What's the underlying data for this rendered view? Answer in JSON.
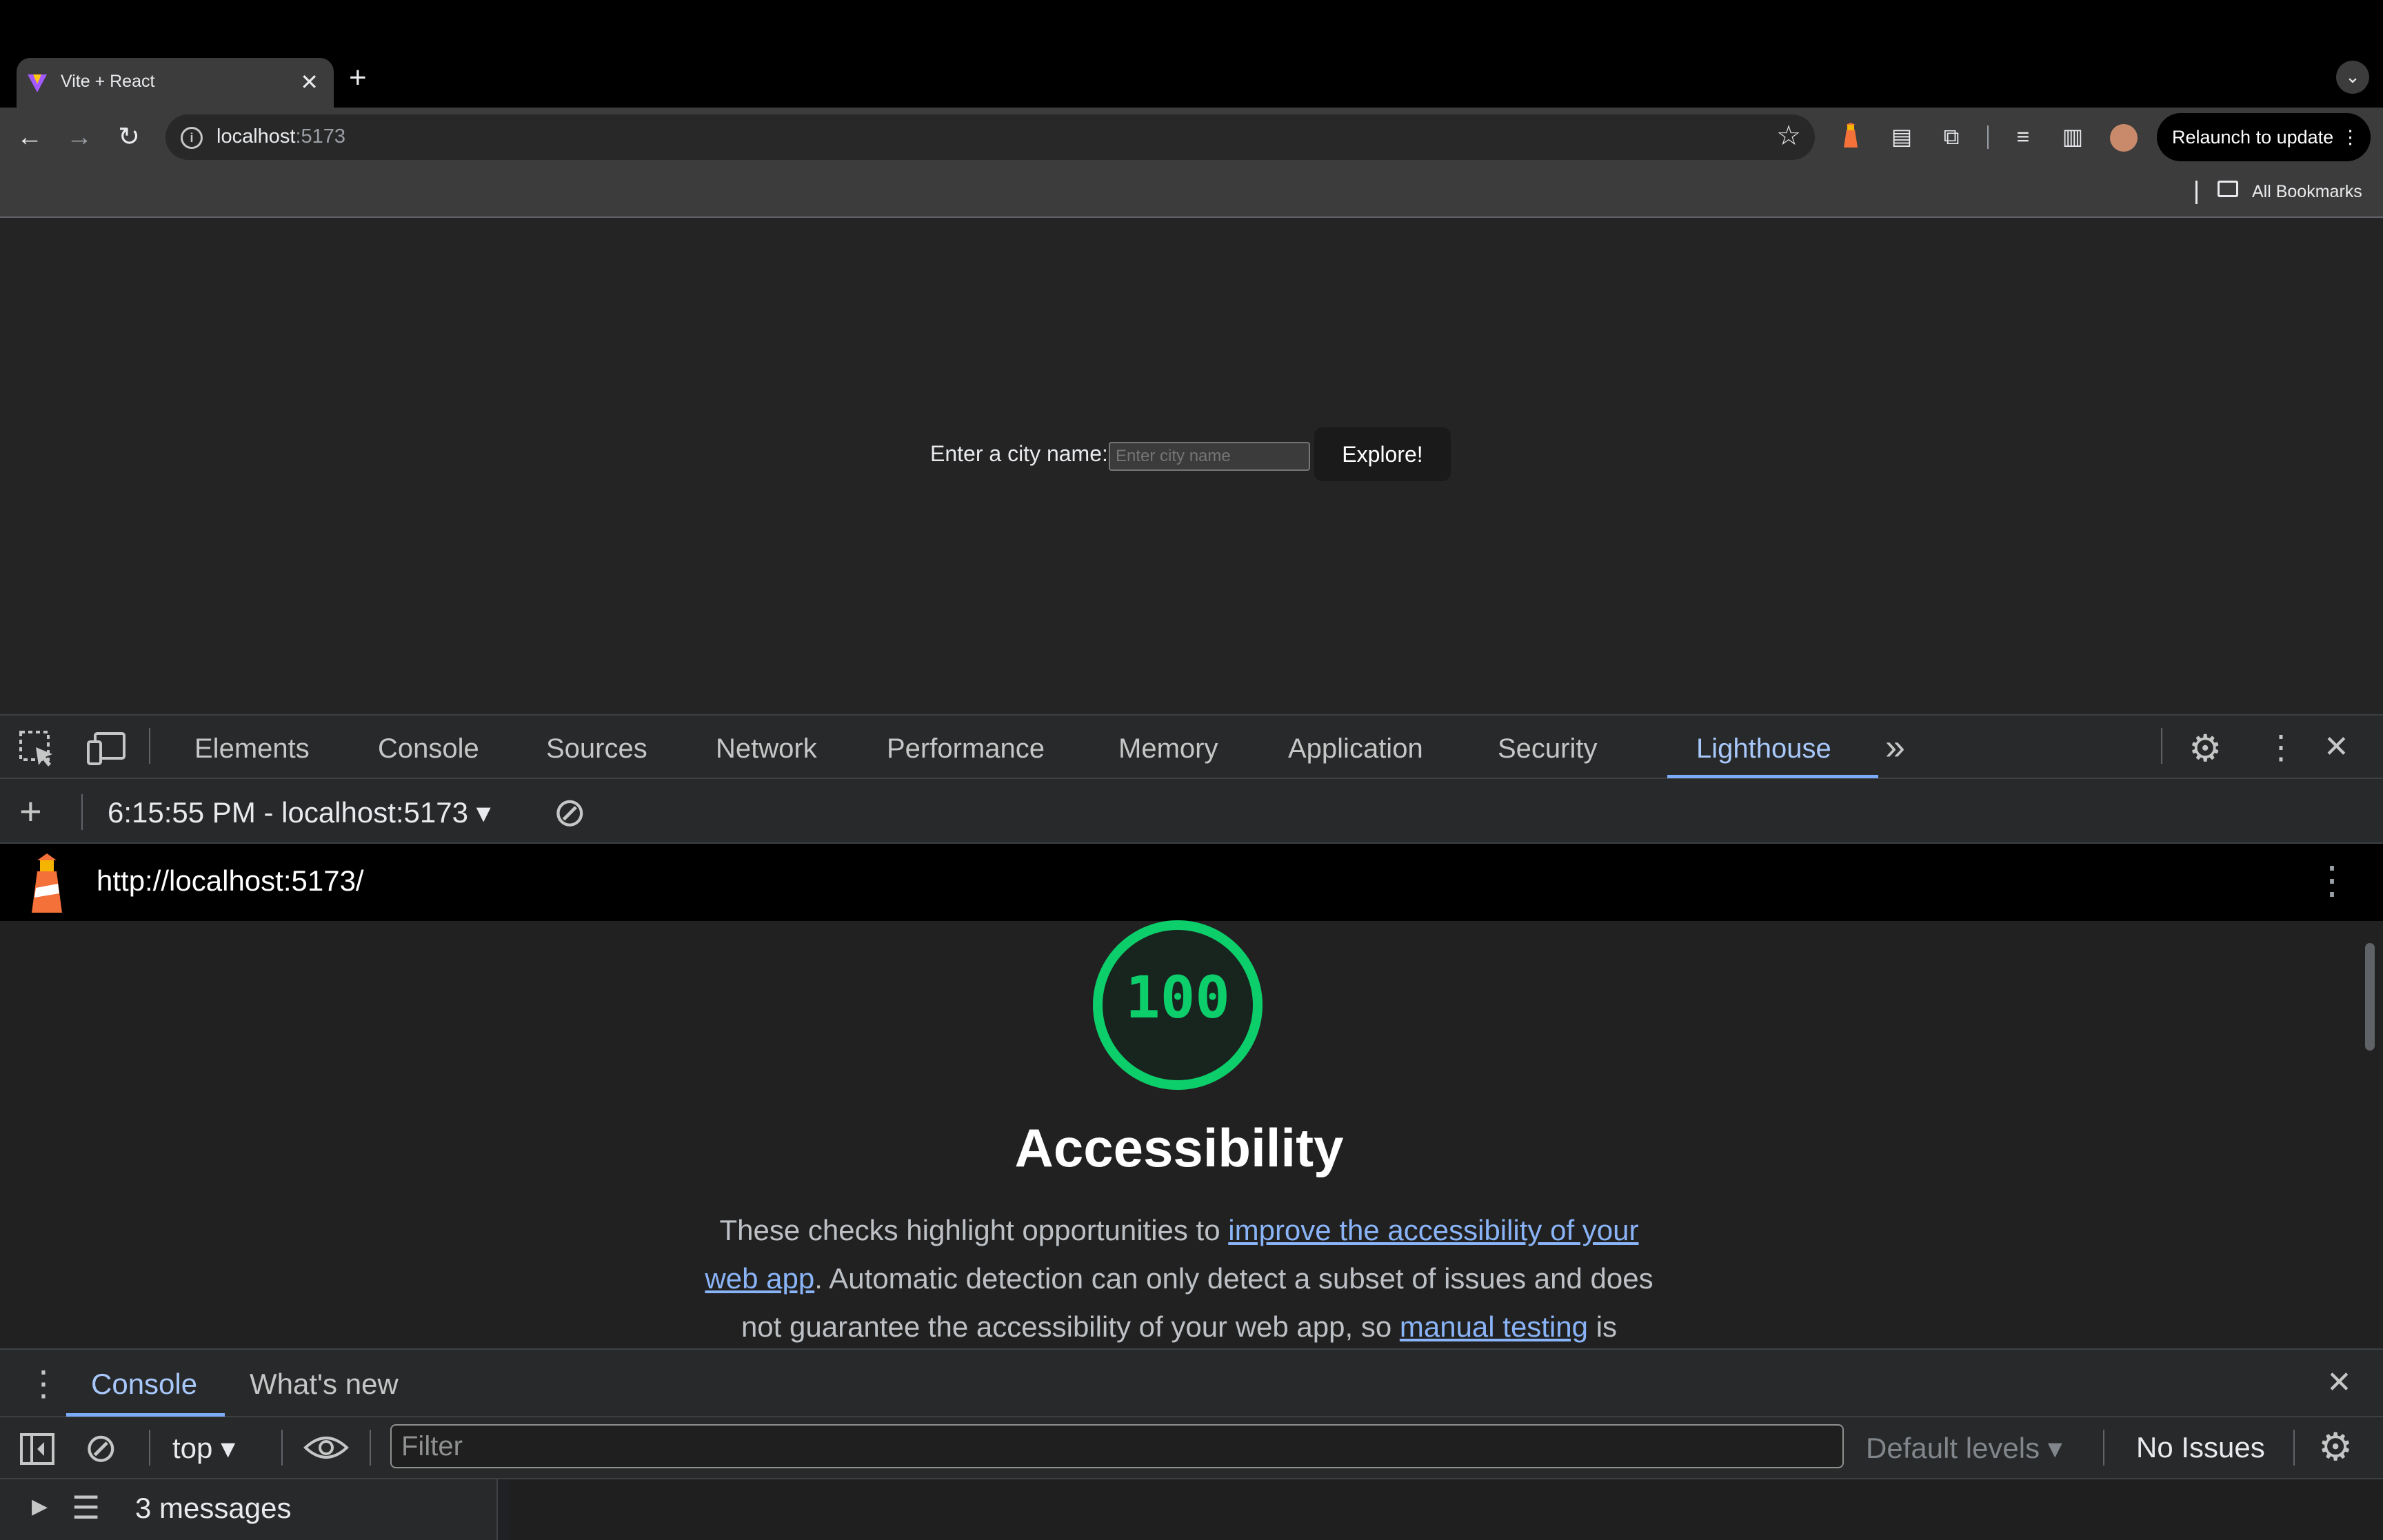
{
  "browser": {
    "tab_title": "Vite + React",
    "tab_close_glyph": "✕",
    "new_tab_glyph": "+",
    "tab_search_glyph": "⌄",
    "url_host": "localhost",
    "url_port": ":5173",
    "relaunch_label": "Relaunch to update",
    "relaunch_menu_glyph": "⋮",
    "bookmarks_label": "All Bookmarks",
    "icons": {
      "back": "←",
      "forward": "→",
      "reload": "↻",
      "star": "☆",
      "ext1": "▮",
      "ext2": "▤",
      "puzzle": "⧉",
      "media": "≡",
      "sidepanel": "▥"
    }
  },
  "page": {
    "city_label": "Enter a city name:",
    "city_placeholder": "Enter city name",
    "explore_label": "Explore!"
  },
  "devtools": {
    "tabs": [
      "Elements",
      "Console",
      "Sources",
      "Network",
      "Performance",
      "Memory",
      "Application",
      "Security",
      "Lighthouse"
    ],
    "active_tab": "Lighthouse",
    "more_tabs_glyph": "»",
    "settings_glyph": "⚙",
    "menu_glyph": "⋮",
    "close_glyph": "✕",
    "lighthouse": {
      "add_glyph": "+",
      "report_selector": "6:15:55 PM - localhost:5173",
      "report_selector_caret": "▾",
      "clear_glyph": "⊘",
      "report_url": "http://localhost:5173/",
      "report_menu_glyph": "⋮",
      "score": "100",
      "score_color": "#0cce6b",
      "category_title": "Accessibility",
      "desc_part1": "These checks highlight opportunities to ",
      "desc_link1": "improve the accessibility of your web app",
      "desc_part2": ". Automatic detection can only detect a subset of issues and does not guarantee the accessibility of your web app, so ",
      "desc_link2": "manual testing",
      "desc_part3": " is"
    },
    "drawer": {
      "menu_glyph": "⋮",
      "tabs": [
        "Console",
        "What's new"
      ],
      "active_tab": "Console",
      "close_glyph": "✕",
      "context": "top",
      "context_caret": "▾",
      "filter_placeholder": "Filter",
      "levels_label": "Default levels",
      "levels_caret": "▾",
      "issues_label": "No Issues",
      "settings_glyph": "⚙",
      "messages_label": "3 messages",
      "expand_glyph": "▶",
      "list_glyph": "☰"
    }
  },
  "colors": {
    "accent_blue": "#a8c7fa",
    "score_green": "#0cce6b",
    "link_blue": "#8ab4f8"
  }
}
